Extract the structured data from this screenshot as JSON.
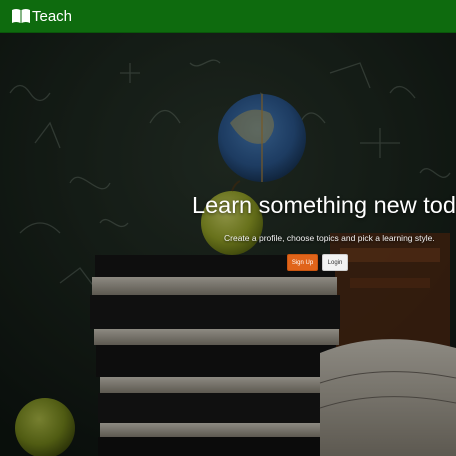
{
  "navbar": {
    "brand_text": "Teach",
    "brand_icon": "open-book-icon",
    "color": "#0e6b0e"
  },
  "hero": {
    "headline": "Learn something new today",
    "subline": "Create a profile, choose topics and pick a learning style.",
    "signup_label": "Sign Up",
    "login_label": "Login",
    "signup_color": "#e0641a",
    "background_image": "chalkboard with stacked books, apples and globe"
  }
}
